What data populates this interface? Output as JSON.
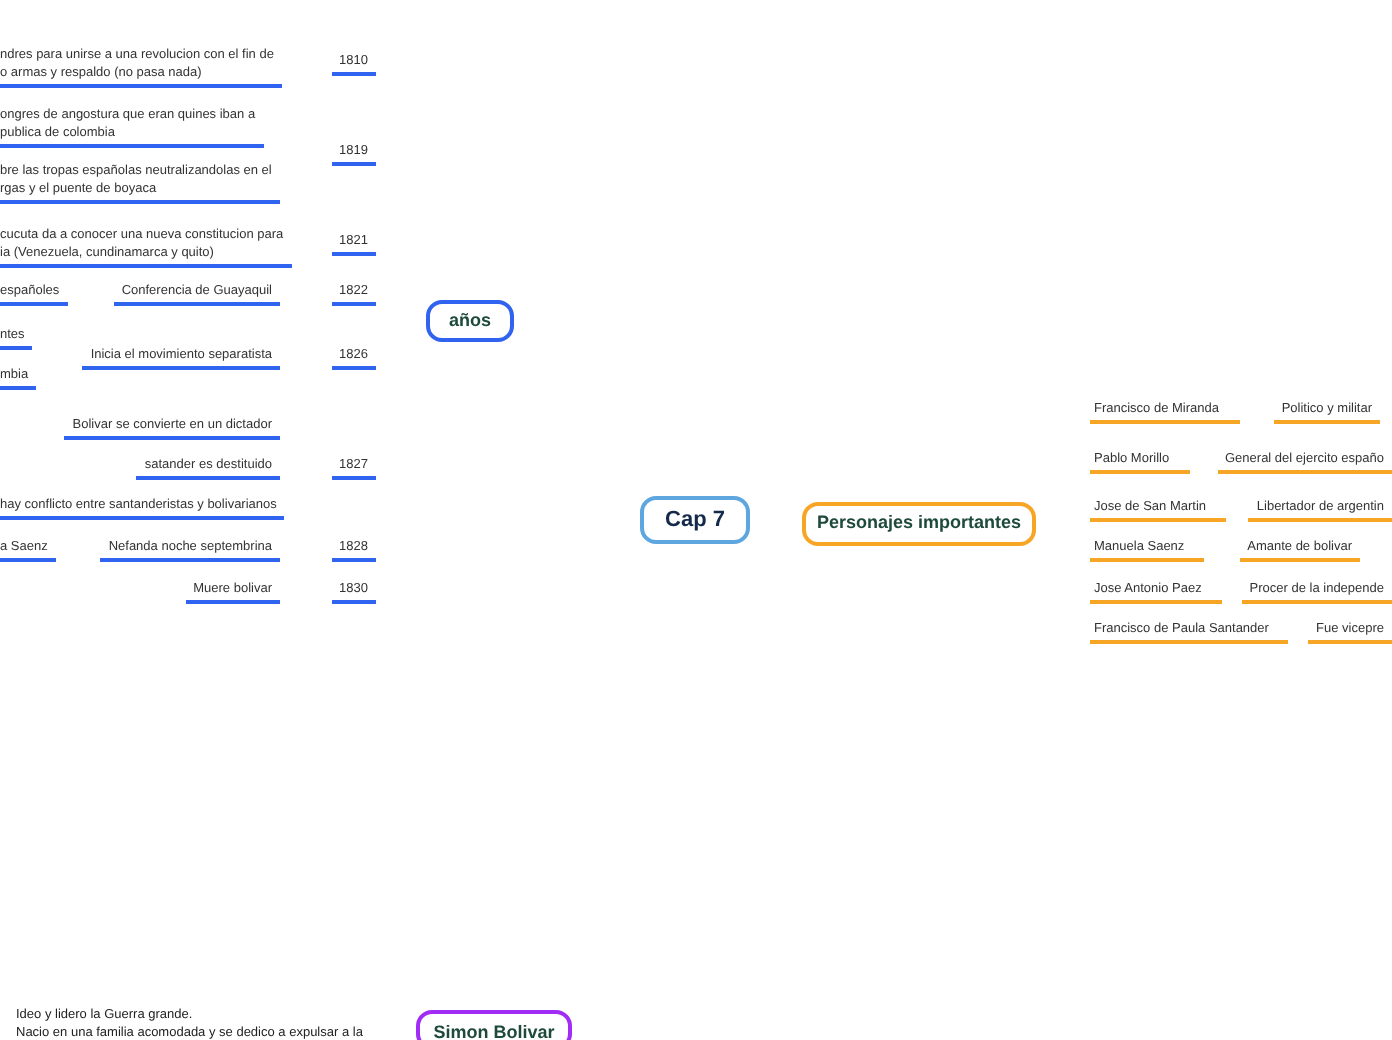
{
  "central": {
    "label": "Cap 7"
  },
  "branches": [
    {
      "label": "años",
      "children": [
        {
          "label": "1810",
          "children": [
            {
              "lines": [
                "ndres para unirse  a una revolucion con el fin de",
                "o armas y respaldo (no pasa nada)"
              ]
            }
          ]
        },
        {
          "label": "1819",
          "children": [
            {
              "lines": [
                "ongres de angostura que eran quines iban a",
                "publica de colombia"
              ]
            },
            {
              "lines": [
                "bre las tropas españolas neutralizandolas en el",
                "rgas y el puente de boyaca"
              ]
            }
          ]
        },
        {
          "label": "1821",
          "children": [
            {
              "lines": [
                "cucuta da a conocer una nueva constitucion para",
                "ia (Venezuela, cundinamarca y quito)"
              ]
            }
          ]
        },
        {
          "label": "1822",
          "children": [
            {
              "label": "Conferencia de Guayaquil",
              "children": [
                {
                  "label": "españoles"
                }
              ]
            }
          ]
        },
        {
          "label": "1826",
          "children": [
            {
              "label": "Inicia el movimiento separatista",
              "children": [
                {
                  "label": "ntes"
                },
                {
                  "label": "mbia"
                }
              ]
            }
          ]
        },
        {
          "label": "1827",
          "children": [
            {
              "label": "Bolivar se convierte en un dictador"
            },
            {
              "label": "satander es destituido"
            },
            {
              "label": "hay conflicto entre santanderistas y bolivarianos"
            }
          ]
        },
        {
          "label": "1828",
          "children": [
            {
              "label": "Nefanda noche septembrina",
              "children": [
                {
                  "label": "a Saenz"
                }
              ]
            }
          ]
        },
        {
          "label": "1830",
          "children": [
            {
              "label": "Muere bolivar"
            }
          ]
        }
      ]
    },
    {
      "label": "Personajes importantes",
      "children": [
        {
          "label": "Francisco de Miranda",
          "children": [
            {
              "label": "Politico y militar"
            }
          ]
        },
        {
          "label": "Pablo Morillo",
          "children": [
            {
              "label": "General del ejercito españo"
            }
          ]
        },
        {
          "label": "Jose de San Martin",
          "children": [
            {
              "label": "Libertador de argentin"
            }
          ]
        },
        {
          "label": "Manuela Saenz",
          "children": [
            {
              "label": "Amante de bolivar"
            }
          ]
        },
        {
          "label": "Jose Antonio Paez",
          "children": [
            {
              "label": "Procer de la independe"
            }
          ]
        },
        {
          "label": "Francisco de Paula Santander",
          "children": [
            {
              "label": "Fue vicepre"
            }
          ]
        }
      ]
    },
    {
      "label": "Simon Bolivar",
      "children": [
        {
          "lines": [
            "Ideo y lidero la Guerra grande.",
            "Nacio en una familia acomodada y se dedico a expulsar a la"
          ]
        }
      ]
    }
  ]
}
